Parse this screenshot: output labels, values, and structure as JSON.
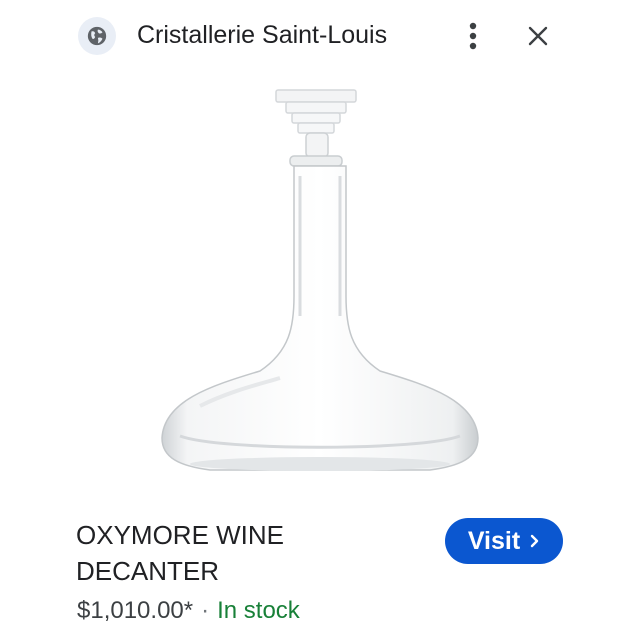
{
  "header": {
    "site_name": "Cristallerie Saint-Louis",
    "site_icon": "globe-icon",
    "more_icon": "more-vertical-icon",
    "close_icon": "close-icon"
  },
  "product": {
    "image_icon": "decanter-image",
    "title": "OXYMORE WINE DECANTER",
    "price": "$1,010.00*",
    "separator": "·",
    "availability": "In stock"
  },
  "actions": {
    "visit_label": "Visit",
    "visit_icon": "chevron-right-icon"
  },
  "colors": {
    "accent": "#0b57d0",
    "in_stock": "#188038",
    "icon_bg": "#e9eef6"
  }
}
